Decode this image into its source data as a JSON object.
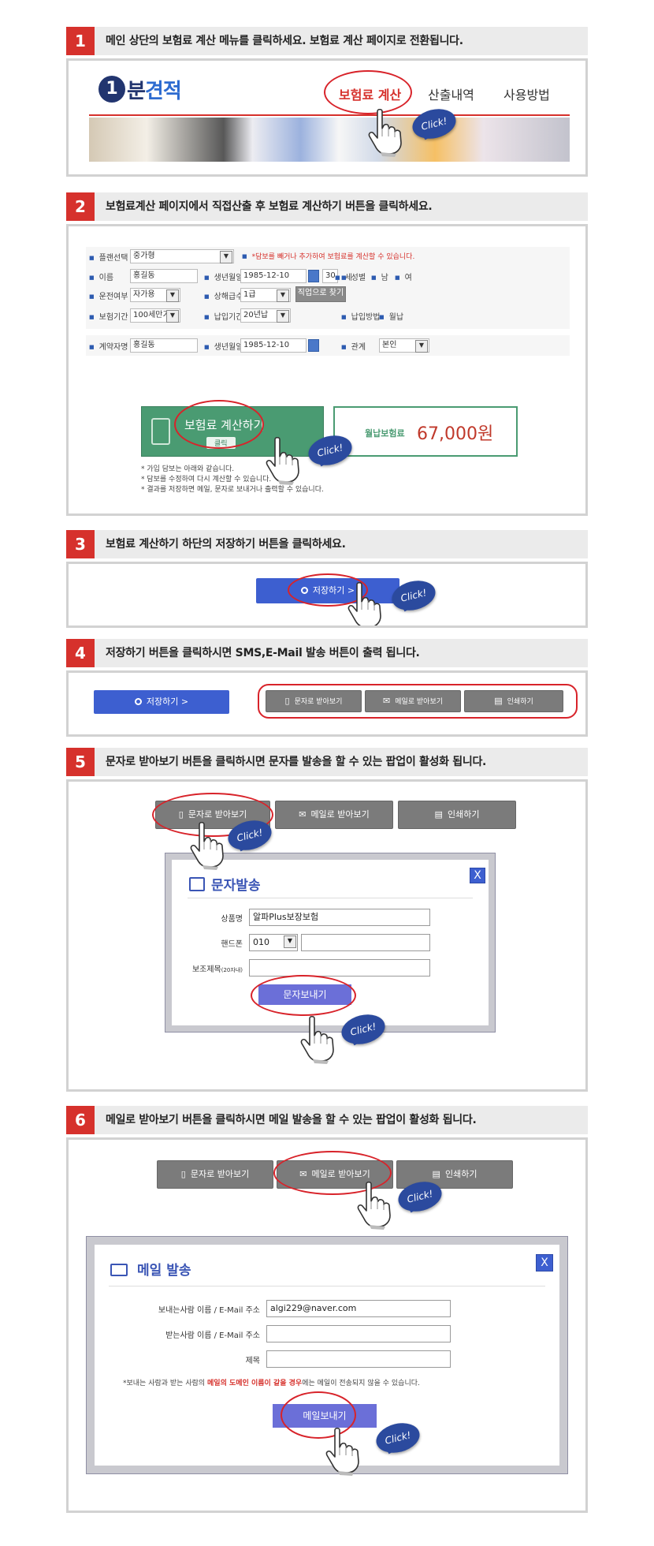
{
  "steps": [
    {
      "num": "1",
      "text": "메인 상단의 보험료 계산 메뉴를 클릭하세요. 보험료 계산 페이지로 전환됩니다."
    },
    {
      "num": "2",
      "text": "보험료계산 페이지에서 직접산출 후 보험료 계산하기 버튼을 클릭하세요."
    },
    {
      "num": "3",
      "text": "보험료 계산하기 하단의 저장하기 버튼을 클릭하세요."
    },
    {
      "num": "4",
      "text": "저장하기 버튼을 클릭하시면 SMS,E-Mail 발송 버튼이 출력 됩니다."
    },
    {
      "num": "5",
      "text": "문자로 받아보기 버튼을 클릭하시면 문자를 발송을 할 수 있는 팝업이 활성화 됩니다."
    },
    {
      "num": "6",
      "text": "메일로 받아보기 버튼을 클릭하시면 메일 발송을 할 수 있는 팝업이 활성화 됩니다."
    }
  ],
  "click_label": "Click!",
  "site": {
    "logo_num": "1",
    "logo_char": "분",
    "logo_text": "견적",
    "nav": [
      "보험료 계산",
      "산출내역",
      "사용방법"
    ]
  },
  "form": {
    "plan_label": "플랜선택",
    "plan_value": "중가형",
    "plan_note": "*담보를 빼거나 추가하여 보험료를 계산할 수 있습니다.",
    "name_label": "이름",
    "name_value": "홍길동",
    "birth_label": "생년월일",
    "birth_value": "1985-12-10",
    "age_value": "30",
    "age_unit": "세",
    "gender_label": "성별",
    "gender_m": "남",
    "gender_f": "여",
    "drive_label": "운전여부",
    "drive_value": "자가용",
    "grade_label": "상해급수",
    "grade_value": "1급",
    "job_button": "직업으로 찾기",
    "period_label": "보험기간",
    "period_value": "100세만기",
    "pay_label": "납입기간",
    "pay_value": "20년납",
    "method_label": "납입방법",
    "method_value": "월납",
    "contractor_label": "계약자명",
    "contractor_value": "홍길동",
    "c_birth_label": "생년월일",
    "c_birth_value": "1985-12-10",
    "relation_label": "관계",
    "relation_value": "본인",
    "calc_button": "보험료 계산하기",
    "calc_sub": "클릭",
    "premium_label": "월납보험료",
    "premium_value": "67,000원",
    "notes": [
      "* 가입 담보는 아래와 같습니다.",
      "* 담보를 수정하여 다시 계산할 수 있습니다.",
      "* 결과를 저장하면 메일, 문자로 보내거나 출력할 수 있습니다."
    ]
  },
  "buttons": {
    "save": "저장하기 >",
    "sms": "문자로 받아보기",
    "mail": "메일로 받아보기",
    "print": "인쇄하기"
  },
  "sms_popup": {
    "title": "문자발송",
    "close": "X",
    "product_label": "상품명",
    "product_value": "알파Plus보장보험",
    "phone_label": "핸드폰",
    "phone_prefix": "010",
    "subject_label": "보조제목",
    "subject_hint": "(20자내)",
    "send": "문자보내기"
  },
  "mail_popup": {
    "title": "메일 발송",
    "close": "X",
    "sender_label": "보내는사람 이름 / E-Mail 주소",
    "sender_value": "algi229@naver.com",
    "receiver_label": "받는사람 이름 / E-Mail 주소",
    "subject_label": "제목",
    "note_a": "*보내는 사람과 받는 사람의 ",
    "note_b": "메일의 도메인 이름이 같을 경우",
    "note_c": "에는 메일이 전송되지 않을 수 있습니다.",
    "send": "메일보내기"
  }
}
